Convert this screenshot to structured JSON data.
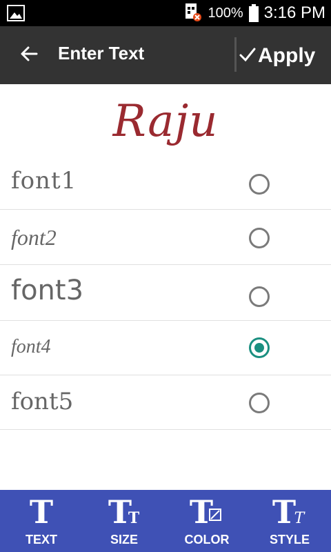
{
  "status_bar": {
    "battery": "100%",
    "time": "3:16 PM"
  },
  "toolbar": {
    "title": "Enter Text",
    "apply_label": "Apply"
  },
  "preview": {
    "text": "Raju"
  },
  "fonts": [
    {
      "label": "font1",
      "selected": false
    },
    {
      "label": "font2",
      "selected": false
    },
    {
      "label": "font3",
      "selected": false
    },
    {
      "label": "font4",
      "selected": true
    },
    {
      "label": "font5",
      "selected": false
    }
  ],
  "bottom_tabs": [
    {
      "label": "TEXT",
      "icon": "text-icon"
    },
    {
      "label": "SIZE",
      "icon": "size-icon"
    },
    {
      "label": "COLOR",
      "icon": "color-icon"
    },
    {
      "label": "STYLE",
      "icon": "style-icon"
    }
  ],
  "colors": {
    "toolbar": "#333333",
    "bottom_bar": "#3f51b5",
    "accent": "#1a8f80",
    "preview_text": "#9a2a30"
  }
}
